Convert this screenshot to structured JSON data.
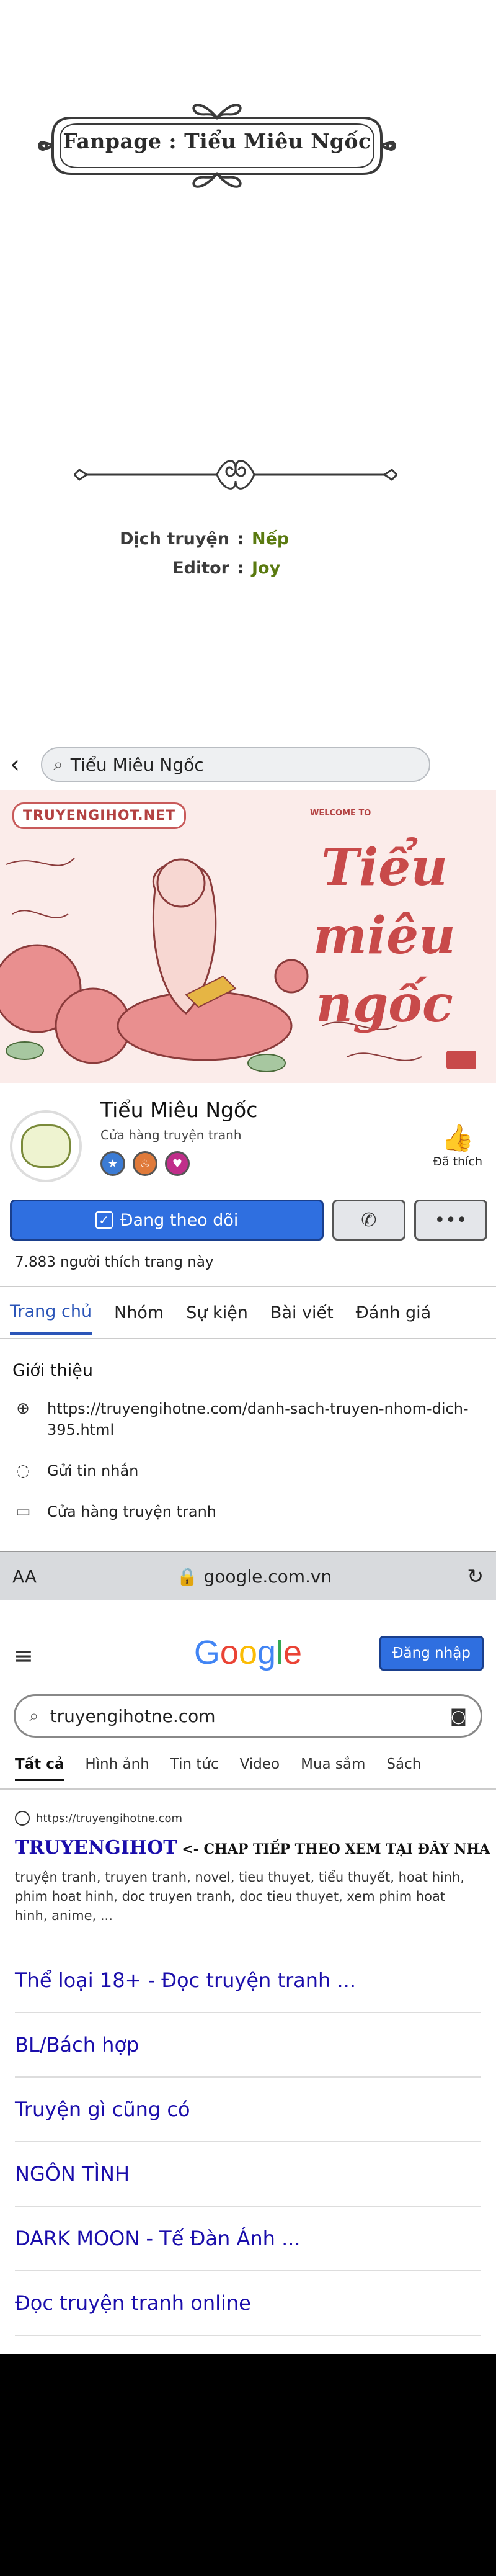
{
  "credits": {
    "banner_text": "Fanpage : Tiểu Miêu Ngốc",
    "rows": [
      {
        "key": "Dịch truyện",
        "sep": ":",
        "value": "Nếp"
      },
      {
        "key": "Editor",
        "sep": ":",
        "value": "Joy"
      }
    ]
  },
  "facebook": {
    "back_icon": "chevron-left-icon",
    "search_text": "Tiểu Miêu Ngốc",
    "cover": {
      "tag": "TRUYENGIHOT.NET",
      "welcome": "WELCOME TO",
      "title_lines": [
        "Tiểu",
        "miêu",
        "ngốc"
      ]
    },
    "page_name": "Tiểu Miêu Ngốc",
    "category": "Cửa hàng truyện tranh",
    "liked_label": "Đã thích",
    "follow_label": "Đang theo dõi",
    "likes_count": "7.883 người thích trang này",
    "tabs": [
      "Trang chủ",
      "Nhóm",
      "Sự kiện",
      "Bài viết",
      "Đánh giá"
    ],
    "active_tab": "Trang chủ",
    "intro_title": "Giới thiệu",
    "intro_link": "https://truyengihotne.com/danh-sach-truyen-nhom-dich-395.html",
    "send_message": "Gửi tin nhắn",
    "shop_label": "Cửa hàng truyện tranh",
    "urlbar": {
      "aa": "AA",
      "domain": "google.com.vn"
    }
  },
  "google": {
    "logo_letters": [
      {
        "ch": "G",
        "color": "#4285f4"
      },
      {
        "ch": "o",
        "color": "#ea4335"
      },
      {
        "ch": "o",
        "color": "#fbbc05"
      },
      {
        "ch": "g",
        "color": "#4285f4"
      },
      {
        "ch": "l",
        "color": "#34a853"
      },
      {
        "ch": "e",
        "color": "#ea4335"
      }
    ],
    "signin_label": "Đăng nhập",
    "query": "truyengihotne.com",
    "tabs": [
      "Tất cả",
      "Hình ảnh",
      "Tin tức",
      "Video",
      "Mua sắm",
      "Sách"
    ],
    "result": {
      "url": "https://truyengihotne.com",
      "title_main": "TRUYENGIHOT",
      "title_rest": " <- CHAP TIẾP THEO XEM TẠI ĐÂY NHA",
      "desc": "truyện tranh, truyen tranh, novel, tieu thuyet, tiểu thuyết, hoat hinh, phim hoat hinh, doc truyen tranh, doc tieu thuyet, xem phim hoat hinh, anime, ..."
    },
    "sitelinks": [
      "Thể loại 18+ - Đọc truyện tranh ...",
      "BL/Bách hợp",
      "Truyện gì cũng có",
      "NGÔN TÌNH",
      "DARK MOON - Tế Đàn Ánh ...",
      "Đọc truyện tranh online"
    ]
  }
}
